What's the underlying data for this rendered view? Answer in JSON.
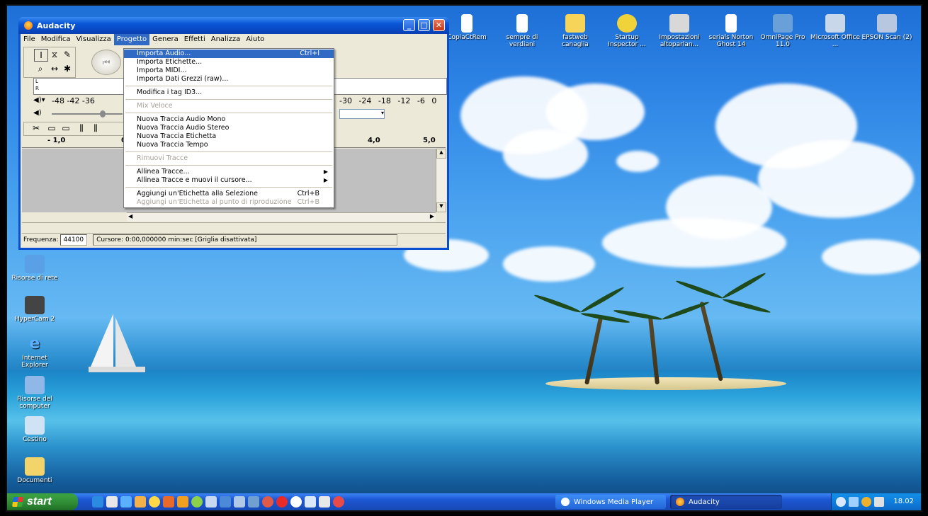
{
  "desktop": {
    "icons_top_partial_label": "CopiaCtRem",
    "icons_top": [
      {
        "label": "sempre di verdiani",
        "icon": "text-file-icon"
      },
      {
        "label": "fastweb canaglia",
        "icon": "folder-icon"
      },
      {
        "label": "Startup Inspector ...",
        "icon": "startup-inspector-icon"
      },
      {
        "label": "Impostazioni altoparlan...",
        "icon": "speaker-settings-icon"
      },
      {
        "label": "serials Norton Ghost 14",
        "icon": "text-file-icon"
      },
      {
        "label": "OmniPage Pro 11.0",
        "icon": "omnipage-icon"
      },
      {
        "label": "Microsoft Office ...",
        "icon": "office-shortcut-icon"
      },
      {
        "label": "EPSON Scan (2)",
        "icon": "epson-scan-icon"
      }
    ],
    "icons_left": [
      {
        "label": "Risorse di rete",
        "icon": "network-places-icon"
      },
      {
        "label": "HyperCam 2",
        "icon": "hypercam-icon"
      },
      {
        "label": "Internet Explorer",
        "icon": "internet-explorer-icon"
      },
      {
        "label": "Risorse del computer",
        "icon": "my-computer-icon"
      },
      {
        "label": "Cestino",
        "icon": "recycle-bin-icon"
      },
      {
        "label": "Documenti",
        "icon": "documents-icon"
      }
    ]
  },
  "window": {
    "title": "Audacity",
    "menubar": [
      "File",
      "Modifica",
      "Visualizza",
      "Progetto",
      "Genera",
      "Effetti",
      "Analizza",
      "Aiuto"
    ],
    "active_menu": "Progetto",
    "meter_scale_left": "-48 -42 -36",
    "meter_scale_right": "-30 -24 -18 -12 -6 0",
    "ruler_left": "- 1,0",
    "ruler_mid": "0",
    "ruler_4": "4,0",
    "ruler_5": "5,0",
    "status": {
      "freq_label": "Frequenza:",
      "freq_value": "44100",
      "cursor": "Cursore: 0:00,000000 min:sec  [Griglia disattivata]"
    }
  },
  "dropdown": {
    "items": [
      {
        "label": "Importa Audio...",
        "shortcut": "Ctrl+I",
        "selected": true
      },
      {
        "label": "Importa Etichette..."
      },
      {
        "label": "Importa MIDI..."
      },
      {
        "label": "Importa Dati Grezzi (raw)..."
      },
      {
        "sep": true
      },
      {
        "label": "Modifica i tag ID3..."
      },
      {
        "sep": true
      },
      {
        "label": "Mix Veloce",
        "disabled": true
      },
      {
        "sep": true
      },
      {
        "label": "Nuova Traccia Audio Mono"
      },
      {
        "label": "Nuova Traccia Audio Stereo"
      },
      {
        "label": "Nuova Traccia Etichetta"
      },
      {
        "label": "Nuova Traccia Tempo"
      },
      {
        "sep": true
      },
      {
        "label": "Rimuovi Tracce",
        "disabled": true
      },
      {
        "sep": true
      },
      {
        "label": "Allinea Tracce...",
        "submenu": true
      },
      {
        "label": "Allinea Tracce e muovi il cursore...",
        "submenu": true
      },
      {
        "sep": true
      },
      {
        "label": "Aggiungi un'Etichetta alla Selezione",
        "shortcut": "Ctrl+B"
      },
      {
        "label": "Aggiungi un'Etichetta al punto di riproduzione",
        "shortcut": "Ctrl+B",
        "disabled": true
      }
    ]
  },
  "taskbar": {
    "start": "start",
    "buttons": [
      {
        "label": "Windows Media Player"
      },
      {
        "label": "Audacity"
      }
    ],
    "clock": "18.02"
  },
  "colors": {
    "selection": "#316ac5",
    "taskbar": "#1c58d4",
    "start": "#2e8b34"
  }
}
